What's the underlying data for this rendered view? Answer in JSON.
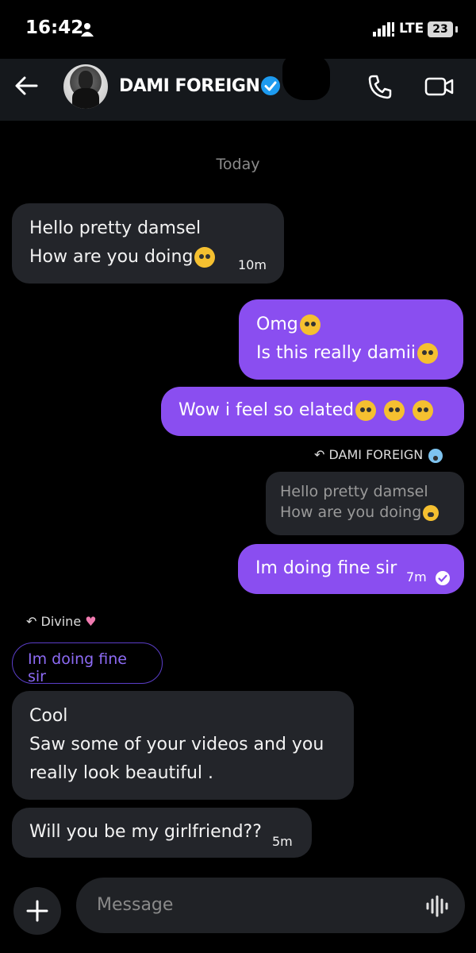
{
  "status_bar": {
    "time": "16:42",
    "network": "LTE",
    "battery": "23"
  },
  "header": {
    "contact_name": "DAMI FOREIGN"
  },
  "day_label": "Today",
  "messages": [
    {
      "line1": "Hello pretty damsel",
      "line2": "How are you doing",
      "time": "10m"
    },
    {
      "line1": "Omg",
      "line2": "Is this really damii"
    },
    {
      "text": "Wow i feel so elated"
    },
    {
      "reply_to": "DAMI FOREIGN",
      "quoted_line1": "Hello pretty damsel",
      "quoted_line2": "How are you doing",
      "text": "Im doing fine sir",
      "time": "7m"
    },
    {
      "reply_to": "Divine",
      "quoted": "Im doing fine sir",
      "line1": "Cool",
      "line2": "Saw some of your videos and you",
      "line3": "really look beautiful ."
    },
    {
      "text": "Will you be my girlfriend??",
      "time": "5m"
    }
  ],
  "composer": {
    "placeholder": "Message"
  },
  "colors": {
    "accent": "#8a4ef0",
    "incoming_bubble": "#23252a",
    "verified": "#1d9bf0"
  },
  "icons": [
    "person-icon",
    "signal-icon",
    "back-icon",
    "verified-icon",
    "phone-icon",
    "video-icon",
    "reply-icon",
    "check-icon",
    "plus-icon",
    "voice-icon"
  ]
}
